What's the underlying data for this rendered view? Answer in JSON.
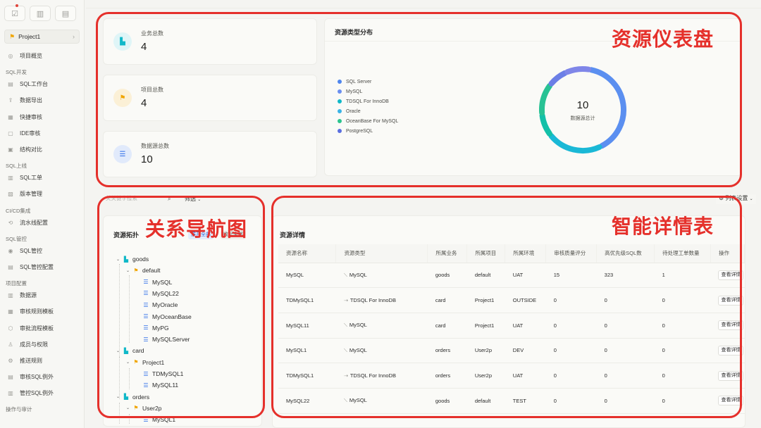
{
  "sidebar": {
    "project": "Project1",
    "items": [
      {
        "type": "item",
        "label": "项目概览",
        "icon": "overview-icon",
        "glyph": "◎"
      },
      {
        "type": "group",
        "label": "SQL开发"
      },
      {
        "type": "item",
        "label": "SQL工作台",
        "icon": "workbench-icon",
        "glyph": "▤"
      },
      {
        "type": "item",
        "label": "数据导出",
        "icon": "export-icon",
        "glyph": "⇪"
      },
      {
        "type": "item",
        "label": "快捷审核",
        "icon": "quick-audit-icon",
        "glyph": "▦"
      },
      {
        "type": "item",
        "label": "IDE审核",
        "icon": "ide-audit-icon",
        "glyph": "▢"
      },
      {
        "type": "item",
        "label": "结构对比",
        "icon": "compare-icon",
        "glyph": "▣"
      },
      {
        "type": "group",
        "label": "SQL上线"
      },
      {
        "type": "item",
        "label": "SQL工单",
        "icon": "ticket-icon",
        "glyph": "▥"
      },
      {
        "type": "item",
        "label": "版本管理",
        "icon": "version-icon",
        "glyph": "▧"
      },
      {
        "type": "group",
        "label": "CI/CD集成"
      },
      {
        "type": "item",
        "label": "流水线配置",
        "icon": "pipeline-icon",
        "glyph": "⟲"
      },
      {
        "type": "group",
        "label": "SQL管控"
      },
      {
        "type": "item",
        "label": "SQL管控",
        "icon": "control-icon",
        "glyph": "◉"
      },
      {
        "type": "item",
        "label": "SQL管控配置",
        "icon": "control-config-icon",
        "glyph": "▤"
      },
      {
        "type": "group",
        "label": "项目配置"
      },
      {
        "type": "item",
        "label": "数据源",
        "icon": "datasource-icon",
        "glyph": "▥"
      },
      {
        "type": "item",
        "label": "审核规则模板",
        "icon": "rule-template-icon",
        "glyph": "▦"
      },
      {
        "type": "item",
        "label": "审批流程模板",
        "icon": "approval-icon",
        "glyph": "⬡"
      },
      {
        "type": "item",
        "label": "成员与权限",
        "icon": "members-icon",
        "glyph": "♙"
      },
      {
        "type": "item",
        "label": "推送规则",
        "icon": "push-icon",
        "glyph": "⚙"
      },
      {
        "type": "item",
        "label": "审核SQL例外",
        "icon": "audit-exception-icon",
        "glyph": "▤"
      },
      {
        "type": "item",
        "label": "管控SQL例外",
        "icon": "control-exception-icon",
        "glyph": "▥"
      },
      {
        "type": "group",
        "label": "操作与审计"
      }
    ]
  },
  "stats": [
    {
      "label": "业务总数",
      "value": "4",
      "icon": "business-icon",
      "color": "#10b8c8",
      "bg": "#dff5f7"
    },
    {
      "label": "项目总数",
      "value": "4",
      "icon": "project-flag-icon",
      "color": "#f0a500",
      "bg": "#fbf0d6"
    },
    {
      "label": "数据源总数",
      "value": "10",
      "icon": "database-icon",
      "color": "#2f6fe8",
      "bg": "#e1eafb"
    }
  ],
  "distribution": {
    "title": "资源类型分布",
    "center_value": "10",
    "center_label": "数据源总计",
    "legend": [
      {
        "name": "SQL Server",
        "color": "#4f86ee"
      },
      {
        "name": "MySQL",
        "color": "#6a8ff0"
      },
      {
        "name": "TDSQL For InnoDB",
        "color": "#10b8c8"
      },
      {
        "name": "Oracle",
        "color": "#3bb3e6"
      },
      {
        "name": "OceanBase For MySQL",
        "color": "#2bc48f"
      },
      {
        "name": "PostgreSQL",
        "color": "#5a6fe0"
      }
    ]
  },
  "filters": {
    "search_placeholder": "关关键字搜索",
    "filter_label": "筛选",
    "column_setting": "列表设置"
  },
  "tree": {
    "title": "资源拓扑",
    "tag1": "展开全部",
    "tag2": "收起全部",
    "nodes": [
      {
        "label": "goods",
        "kind": "biz",
        "level": 0
      },
      {
        "label": "default",
        "kind": "proj",
        "level": 1
      },
      {
        "label": "MySQL",
        "kind": "db",
        "level": 2
      },
      {
        "label": "MySQL22",
        "kind": "db",
        "level": 2
      },
      {
        "label": "MyOracle",
        "kind": "db",
        "level": 2
      },
      {
        "label": "MyOceanBase",
        "kind": "db",
        "level": 2
      },
      {
        "label": "MyPG",
        "kind": "db",
        "level": 2
      },
      {
        "label": "MySQLServer",
        "kind": "db",
        "level": 2
      },
      {
        "label": "card",
        "kind": "biz",
        "level": 0
      },
      {
        "label": "Project1",
        "kind": "proj",
        "level": 1
      },
      {
        "label": "TDMySQL1",
        "kind": "db",
        "level": 2
      },
      {
        "label": "MySQL11",
        "kind": "db",
        "level": 2
      },
      {
        "label": "orders",
        "kind": "biz",
        "level": 0
      },
      {
        "label": "User2p",
        "kind": "proj",
        "level": 1
      },
      {
        "label": "MySQL1",
        "kind": "db",
        "level": 2
      }
    ]
  },
  "table": {
    "title": "资源详情",
    "headers": [
      "资源名称",
      "资源类型",
      "所属业务",
      "所属项目",
      "所属环境",
      "审核质量评分",
      "高优先级SQL数",
      "待处理工单数量",
      "操作"
    ],
    "action_label": "查看详情",
    "rows": [
      {
        "name": "MySQL",
        "type": "MySQL",
        "biz": "goods",
        "proj": "default",
        "env": "UAT",
        "score": "15",
        "high": "323",
        "pending": "1"
      },
      {
        "name": "TDMySQL1",
        "type": "TDSQL For InnoDB",
        "biz": "card",
        "proj": "Project1",
        "env": "OUTSIDE",
        "score": "0",
        "high": "0",
        "pending": "0"
      },
      {
        "name": "MySQL11",
        "type": "MySQL",
        "biz": "card",
        "proj": "Project1",
        "env": "UAT",
        "score": "0",
        "high": "0",
        "pending": "0"
      },
      {
        "name": "MySQL1",
        "type": "MySQL",
        "biz": "orders",
        "proj": "User2p",
        "env": "DEV",
        "score": "0",
        "high": "0",
        "pending": "0"
      },
      {
        "name": "TDMySQL1",
        "type": "TDSQL For InnoDB",
        "biz": "orders",
        "proj": "User2p",
        "env": "UAT",
        "score": "0",
        "high": "0",
        "pending": "0"
      },
      {
        "name": "MySQL22",
        "type": "MySQL",
        "biz": "goods",
        "proj": "default",
        "env": "TEST",
        "score": "0",
        "high": "0",
        "pending": "0"
      }
    ]
  },
  "annotations": {
    "dashboard": "资源仪表盘",
    "navigator": "关系导航图",
    "detail": "智能详情表",
    "color": "#e5302b"
  }
}
